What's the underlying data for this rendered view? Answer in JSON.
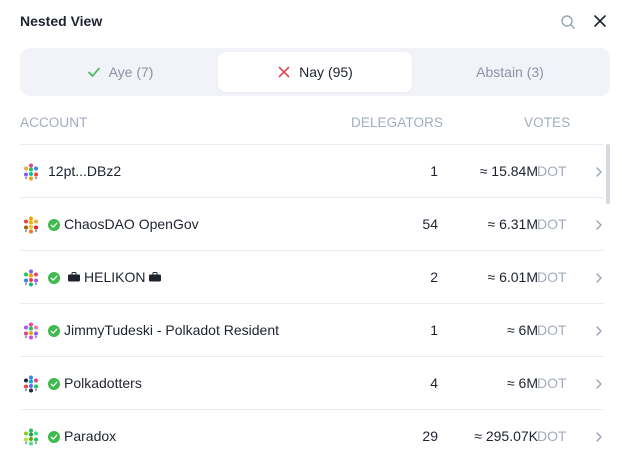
{
  "header": {
    "title": "Nested View"
  },
  "tabs": [
    {
      "label": "Aye (7)",
      "icon": "check-icon",
      "color": "#3fb950"
    },
    {
      "label": "Nay (95)",
      "icon": "cross-icon",
      "color": "#e5484d"
    },
    {
      "label": "Abstain (3)"
    }
  ],
  "active_tab": "Nay (95)",
  "columns": {
    "account": "ACCOUNT",
    "delegators": "DELEGATORS",
    "votes": "VOTES"
  },
  "rows": [
    {
      "name": "12pt...DBz2",
      "verified": false,
      "delegators": "1",
      "votes": "≈ 15.84M",
      "unit": "DOT"
    },
    {
      "name": "ChaosDAO OpenGov",
      "verified": true,
      "delegators": "54",
      "votes": "≈ 6.31M",
      "unit": "DOT"
    },
    {
      "name": "HELIKON",
      "verified": true,
      "suitcase": true,
      "delegators": "2",
      "votes": "≈ 6.01M",
      "unit": "DOT"
    },
    {
      "name": "JimmyTudeski - Polkadot Resident",
      "verified": true,
      "delegators": "1",
      "votes": "≈ 6M",
      "unit": "DOT"
    },
    {
      "name": "Polkadotters",
      "verified": true,
      "delegators": "4",
      "votes": "≈ 6M",
      "unit": "DOT"
    },
    {
      "name": "Paradox",
      "verified": true,
      "delegators": "29",
      "votes": "≈ 295.07K",
      "unit": "DOT"
    }
  ],
  "colors": {
    "verified": "#3fb950",
    "muted": "#a3acbd",
    "divider": "#e8ebf1"
  }
}
